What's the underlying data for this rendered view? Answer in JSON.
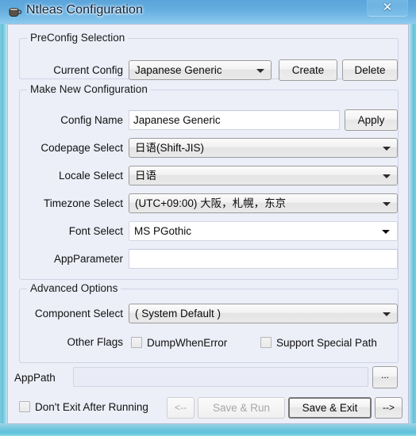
{
  "window": {
    "title": "Ntleas Configuration",
    "icon": "coffee-cup-icon",
    "close_label": "✕"
  },
  "preconfig": {
    "group_title": "PreConfig Selection",
    "current_config_label": "Current Config",
    "current_config_value": "Japanese Generic",
    "create_label": "Create",
    "delete_label": "Delete"
  },
  "make_new": {
    "group_title": "Make New Configuration",
    "config_name_label": "Config Name",
    "config_name_value": "Japanese Generic",
    "apply_label": "Apply",
    "codepage_label": "Codepage Select",
    "codepage_value": "日语(Shift-JIS)",
    "locale_label": "Locale Select",
    "locale_value": "日语",
    "timezone_label": "Timezone Select",
    "timezone_value": "(UTC+09:00) 大阪，札幌，东京",
    "font_label": "Font Select",
    "font_value": "MS PGothic",
    "appparameter_label": "AppParameter",
    "appparameter_value": ""
  },
  "advanced": {
    "group_title": "Advanced Options",
    "component_label": "Component Select",
    "component_value": "( System Default )",
    "other_flags_label": "Other Flags",
    "dump_when_error_label": "DumpWhenError",
    "dump_when_error_checked": false,
    "support_special_path_label": "Support Special Path",
    "support_special_path_checked": false
  },
  "footer": {
    "apppath_label": "AppPath",
    "apppath_value": "",
    "browse_label": "...",
    "dont_exit_label": "Don't Exit After Running",
    "dont_exit_checked": false,
    "back_label": "<--",
    "save_run_label": "Save & Run",
    "save_exit_label": "Save & Exit",
    "forward_label": "-->"
  }
}
